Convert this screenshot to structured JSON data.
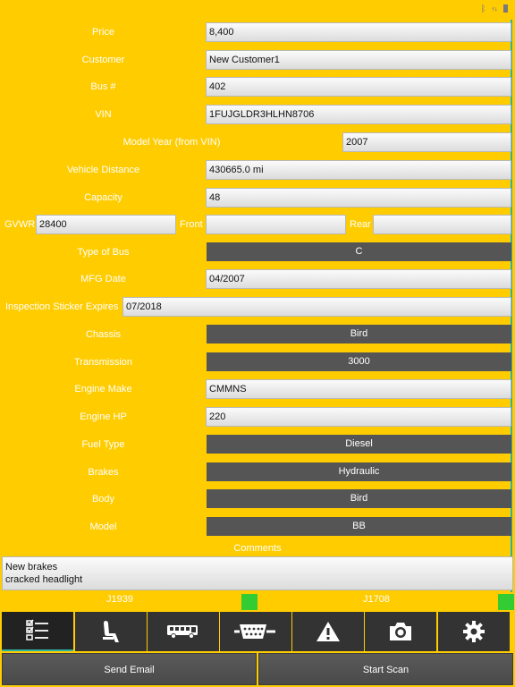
{
  "status": {
    "icons": [
      "bluetooth-icon",
      "sync-icon",
      "battery-icon"
    ]
  },
  "form": {
    "price": {
      "label": "Price",
      "value": "8,400"
    },
    "customer": {
      "label": "Customer",
      "value": "New Customer1"
    },
    "bus_no": {
      "label": "Bus #",
      "value": "402"
    },
    "vin": {
      "label": "VIN",
      "value": "1FUJGLDR3HLHN8706"
    },
    "model_year": {
      "label": "Model Year (from VIN)",
      "value": "2007"
    },
    "vehicle_distance": {
      "label": "Vehicle Distance",
      "value": "430665.0 mi"
    },
    "capacity": {
      "label": "Capacity",
      "value": "48"
    },
    "gvwr": {
      "label": "GVWR",
      "value": "28400"
    },
    "front": {
      "label": "Front",
      "value": ""
    },
    "rear": {
      "label": "Rear",
      "value": ""
    },
    "type_of_bus": {
      "label": "Type of Bus",
      "value": "C"
    },
    "mfg_date": {
      "label": "MFG Date",
      "value": "04/2007"
    },
    "inspection_sticker": {
      "label": "Inspection Sticker Expires",
      "value": "07/2018"
    },
    "chassis": {
      "label": "Chassis",
      "value": "Bird"
    },
    "transmission": {
      "label": "Transmission",
      "value": "3000"
    },
    "engine_make": {
      "label": "Engine Make",
      "value": "CMMNS"
    },
    "engine_hp": {
      "label": "Engine HP",
      "value": "220"
    },
    "fuel_type": {
      "label": "Fuel Type",
      "value": "Diesel"
    },
    "brakes": {
      "label": "Brakes",
      "value": "Hydraulic"
    },
    "body": {
      "label": "Body",
      "value": "Bird"
    },
    "model": {
      "label": "Model",
      "value": "BB"
    },
    "comments": {
      "label": "Comments",
      "line1": "New brakes",
      "line2": "cracked headlight"
    }
  },
  "protocols": {
    "j1939": {
      "label": "J1939",
      "color": "#33cc33"
    },
    "j1708": {
      "label": "J1708",
      "color": "#33cc33"
    }
  },
  "nav": [
    {
      "icon": "checklist-icon"
    },
    {
      "icon": "seat-icon"
    },
    {
      "icon": "bus-icon"
    },
    {
      "icon": "connector-icon"
    },
    {
      "icon": "warning-icon"
    },
    {
      "icon": "camera-icon"
    },
    {
      "icon": "gear-icon"
    }
  ],
  "actions": {
    "send_email": "Send Email",
    "start_scan": "Start Scan"
  }
}
